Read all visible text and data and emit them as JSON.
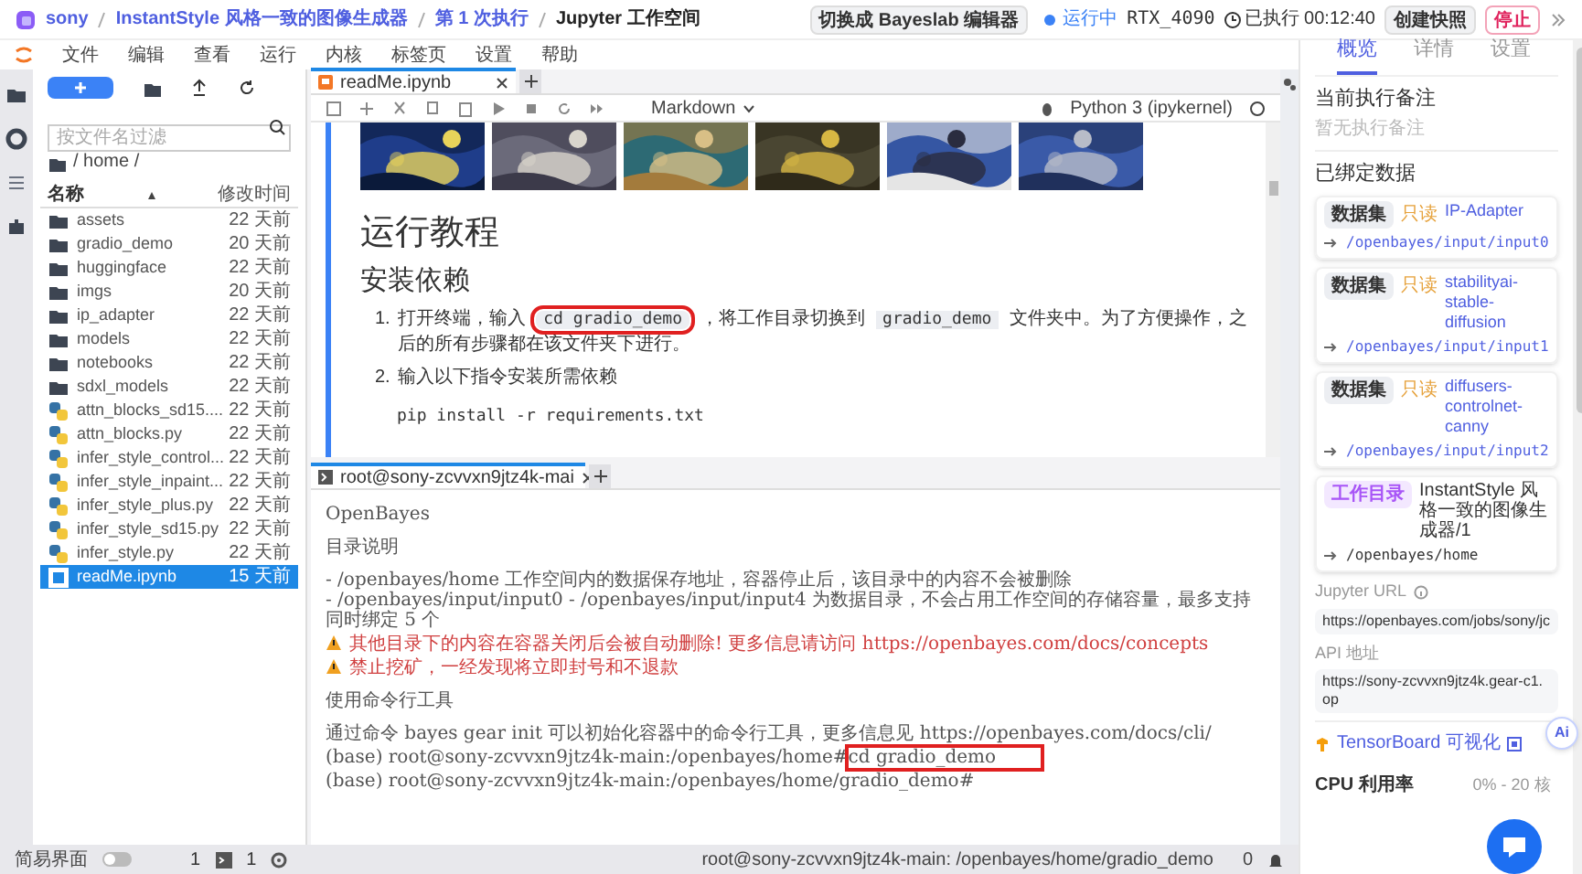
{
  "header": {
    "breadcrumb": [
      {
        "text": "sony"
      },
      {
        "text": "InstantStyle 风格一致的图像生成器"
      },
      {
        "text": "第 1 次执行"
      },
      {
        "text": "Jupyter 工作空间"
      }
    ],
    "switch_button": "切换成 Bayeslab 编辑器",
    "status": "运行中",
    "gpu": "RTX_4090",
    "elapsed": "已执行 00:12:40",
    "snapshot_button": "创建快照",
    "stop_button": "停止"
  },
  "menu": [
    "文件",
    "编辑",
    "查看",
    "运行",
    "内核",
    "标签页",
    "设置",
    "帮助"
  ],
  "file_browser": {
    "filter_placeholder": "按文件名过滤",
    "path": "/ home /",
    "columns": [
      "名称",
      "修改时间"
    ],
    "files": [
      {
        "name": "assets",
        "modified": "22 天前",
        "kind": "folder",
        "selected": false
      },
      {
        "name": "gradio_demo",
        "modified": "20 天前",
        "kind": "folder",
        "selected": false
      },
      {
        "name": "huggingface",
        "modified": "22 天前",
        "kind": "folder",
        "selected": false
      },
      {
        "name": "imgs",
        "modified": "20 天前",
        "kind": "folder",
        "selected": false
      },
      {
        "name": "ip_adapter",
        "modified": "22 天前",
        "kind": "folder",
        "selected": false
      },
      {
        "name": "models",
        "modified": "22 天前",
        "kind": "folder",
        "selected": false
      },
      {
        "name": "notebooks",
        "modified": "22 天前",
        "kind": "folder",
        "selected": false
      },
      {
        "name": "sdxl_models",
        "modified": "22 天前",
        "kind": "folder",
        "selected": false
      },
      {
        "name": "attn_blocks_sd15....",
        "modified": "22 天前",
        "kind": "python",
        "selected": false
      },
      {
        "name": "attn_blocks.py",
        "modified": "22 天前",
        "kind": "python",
        "selected": false
      },
      {
        "name": "infer_style_control...",
        "modified": "22 天前",
        "kind": "python",
        "selected": false
      },
      {
        "name": "infer_style_inpaint...",
        "modified": "22 天前",
        "kind": "python",
        "selected": false
      },
      {
        "name": "infer_style_plus.py",
        "modified": "22 天前",
        "kind": "python",
        "selected": false
      },
      {
        "name": "infer_style_sd15.py",
        "modified": "22 天前",
        "kind": "python",
        "selected": false
      },
      {
        "name": "infer_style.py",
        "modified": "22 天前",
        "kind": "python",
        "selected": false
      },
      {
        "name": "readMe.ipynb",
        "modified": "15 天前",
        "kind": "notebook",
        "selected": true
      }
    ]
  },
  "bottom_bar": {
    "simple_mode_label": "简易界面",
    "simple_mode_on": false,
    "count_1": "1",
    "count_2": "1"
  },
  "notebook": {
    "tab": "readMe.ipynb",
    "cell_type": "Markdown",
    "kernel": "Python 3 (ipykernel)",
    "heading": "运行教程",
    "subheading": "安装依赖",
    "steps": [
      {
        "number": "1.",
        "parts": [
          {
            "kind": "text",
            "text": "打开终端，输入 "
          },
          {
            "kind": "code",
            "text": "cd gradio_demo",
            "highlighted": true
          },
          {
            "kind": "text",
            "text": " ，将工作目录切换到 "
          },
          {
            "kind": "code",
            "text": "gradio_demo"
          },
          {
            "kind": "text",
            "text": " 文件夹中。为了方便操作，之后的所有步骤都在该文件夹下进行。"
          }
        ]
      },
      {
        "number": "2.",
        "parts": [
          {
            "kind": "text",
            "text": "输入以下指令安装所需依赖"
          }
        ]
      }
    ],
    "code": "pip install -r requirements.txt"
  },
  "terminal": {
    "tab": "root@sony-zcvvxn9jtz4k-mai",
    "lines": [
      {
        "kind": "plain",
        "text": "OpenBayes"
      },
      {
        "kind": "plain",
        "text": "目录说明"
      },
      {
        "kind": "plain",
        "text": "- /openbayes/home 工作空间内的数据保存地址，容器停止后，该目录中的内容不会被删除\n- /openbayes/input/input0 - /openbayes/input/input4 为数据目录，不会占用工作空间的存储容量，最多支持同时绑定 5 个"
      },
      {
        "kind": "warning",
        "text": "其他目录下的内容在容器关闭后会被自动删除! 更多信息请访问 https://openbayes.com/docs/concepts"
      },
      {
        "kind": "warning",
        "text": "禁止挖矿，一经发现将立即封号和不退款"
      },
      {
        "kind": "plain",
        "text": "使用命令行工具"
      },
      {
        "kind": "plain",
        "text": "通过命令 bayes gear init 可以初始化容器中的命令行工具，更多信息见 https://openbayes.com/docs/cli/"
      },
      {
        "kind": "prompt",
        "prompt": "(base) root@sony-zcvvxn9jtz4k-main:/openbayes/home#",
        "command": "cd gradio_demo",
        "highlighted": true
      },
      {
        "kind": "prompt",
        "prompt": "(base) root@sony-zcvvxn9jtz4k-main:/openbayes/home/gradio_demo#"
      }
    ]
  },
  "status_bar": {
    "path": "root@sony-zcvvxn9jtz4k-main: /openbayes/home/gradio_demo",
    "count": "0"
  },
  "right_panel": {
    "tabs": [
      {
        "label": "概览",
        "selected": true
      },
      {
        "label": "详情",
        "selected": false
      },
      {
        "label": "设置",
        "selected": false
      }
    ],
    "note_title": "当前执行备注",
    "note_empty": "暂无执行备注",
    "bound_title": "已绑定数据",
    "bindings": [
      {
        "kind": "dataset",
        "tag": "数据集",
        "access": "只读",
        "name": "IP-Adapter",
        "path": "/openbayes/input/input0"
      },
      {
        "kind": "dataset",
        "tag": "数据集",
        "access": "只读",
        "name": "stabilityai-stable-diffusion",
        "path": "/openbayes/input/input1"
      },
      {
        "kind": "dataset",
        "tag": "数据集",
        "access": "只读",
        "name": "diffusers-controlnet-canny",
        "path": "/openbayes/input/input2"
      },
      {
        "kind": "workdir",
        "tag": "工作目录",
        "name": "InstantStyle 风格一致的图像生成器/1",
        "path": "/openbayes/home"
      }
    ],
    "jupyter_label": "Jupyter URL",
    "jupyter_url": "https://openbayes.com/jobs/sony/jc",
    "api_label": "API 地址",
    "api_url": "https://sony-zcvvxn9jtz4k.gear-c1.op",
    "tensorboard": "TensorBoard 可视化",
    "cpu_label": "CPU 利用率",
    "cpu_reading": "0% - 20 核",
    "ai_badge": "Ai"
  }
}
